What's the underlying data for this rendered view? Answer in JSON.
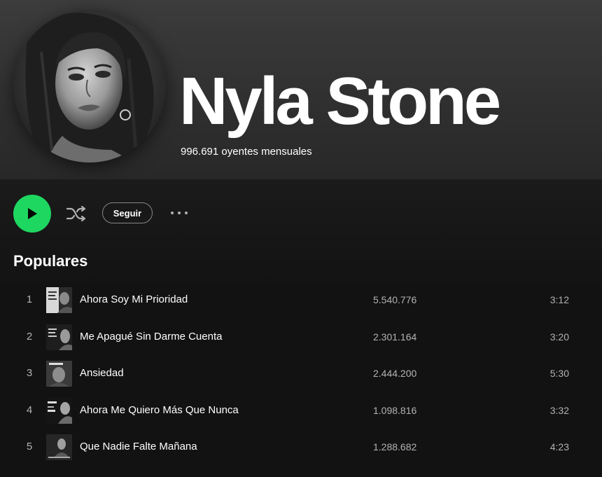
{
  "artist": {
    "name": "Nyla Stone",
    "monthly_listeners": "996.691 oyentes mensuales"
  },
  "actions": {
    "play_icon": "play-icon",
    "shuffle_icon": "shuffle-icon",
    "follow_label": "Seguir",
    "more_icon": "more-options-icon",
    "accent_color": "#1ed760"
  },
  "popular": {
    "title": "Populares",
    "tracks": [
      {
        "num": "1",
        "title": "Ahora Soy Mi Prioridad",
        "plays": "5.540.776",
        "duration": "3:12"
      },
      {
        "num": "2",
        "title": "Me Apagué Sin Darme Cuenta",
        "plays": "2.301.164",
        "duration": "3:20"
      },
      {
        "num": "3",
        "title": "Ansiedad",
        "plays": "2.444.200",
        "duration": "5:30"
      },
      {
        "num": "4",
        "title": "Ahora Me Quiero Más Que Nunca",
        "plays": "1.098.816",
        "duration": "3:32"
      },
      {
        "num": "5",
        "title": "Que Nadie Falte Mañana",
        "plays": "1.288.682",
        "duration": "4:23"
      }
    ]
  }
}
